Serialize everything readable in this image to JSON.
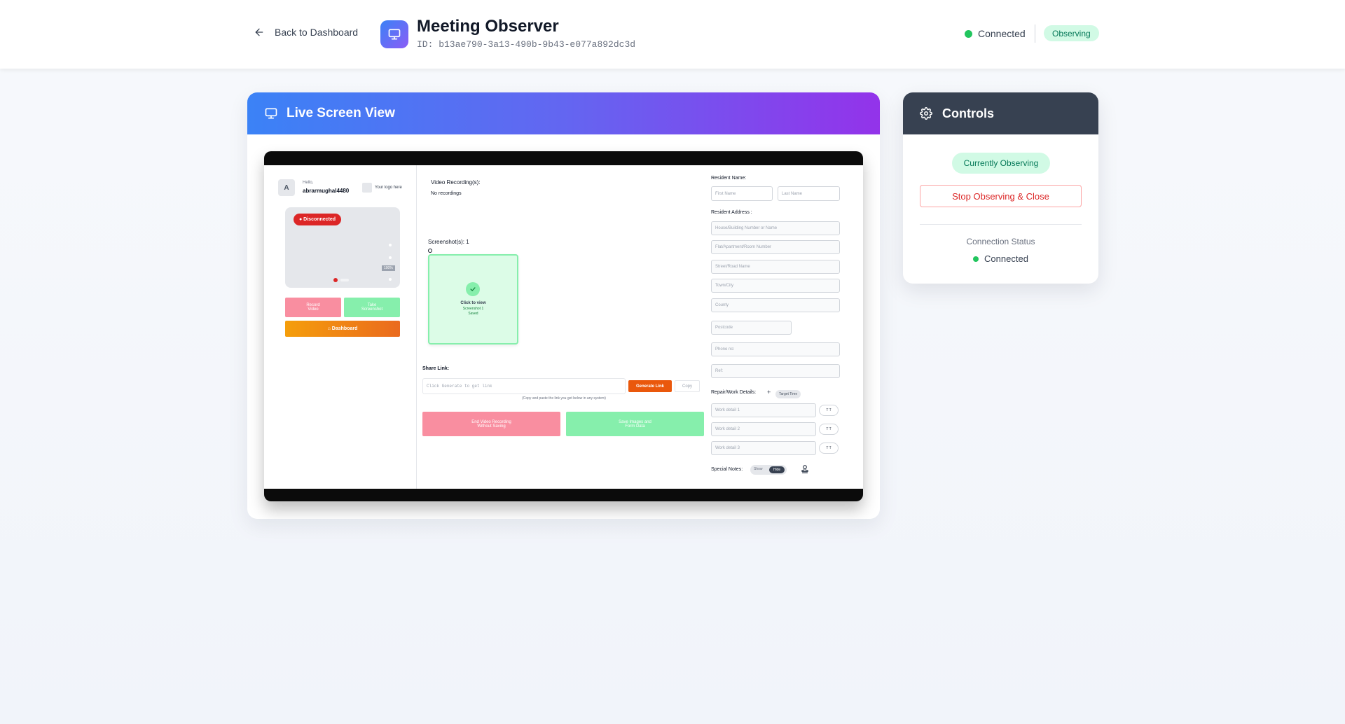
{
  "header": {
    "back_label": "Back to Dashboard",
    "title": "Meeting Observer",
    "id_text": "ID: b13ae790-3a13-490b-9b43-e077a892dc3d",
    "connection": "Connected",
    "observing_badge": "Observing"
  },
  "live": {
    "title": "Live Screen View"
  },
  "mini": {
    "avatar_letter": "A",
    "hello": "Hello,",
    "username": "abrarmughal4480",
    "logo_placeholder": "Your logo here",
    "disconnected": "● Disconnected",
    "zoom": "100%",
    "record_video": "Record\nVideo",
    "take_screenshot": "Take\nScreenshot",
    "dashboard": "⌂ Dashboard",
    "video_recordings_label": "Video Recording(s):",
    "no_recordings": "No recordings",
    "screenshots_label": "Screenshot(s): 1",
    "click_to_view": "Click to view",
    "screenshot_sub": "Screenshot 1",
    "saved": "Saved",
    "share_link": "Share Link:",
    "link_placeholder": "Click Generate to get link",
    "generate_link": "Generate Link",
    "copy": "Copy",
    "copy_hint": "(Copy and paste the link you get below in any system)",
    "end_video": "End Video Recording\nWithout Saving",
    "save_images": "Save Images and\nForm Data",
    "resident_name": "Resident Name:",
    "first_name": "First Name",
    "last_name": "Last Name",
    "resident_address": "Resident Address :",
    "house": "House/Building Number or Name",
    "flat": "Flat/Apartment/Room Number",
    "street": "Street/Road Name",
    "town": "Town/City",
    "county": "County",
    "postcode": "Postcode",
    "phone": "Phone no:",
    "ref": "Ref:",
    "repair_details": "Repair/Work Details:",
    "plus": "+",
    "target_time": "Target Time",
    "work1": "Work detail 1",
    "work2": "Work detail 2",
    "work3": "Work detail 3",
    "tt": "T T",
    "special_notes": "Special Notes:",
    "show": "Show",
    "hide": "Hide"
  },
  "controls": {
    "title": "Controls",
    "currently_observing": "Currently Observing",
    "stop_button": "Stop Observing & Close",
    "connection_status_label": "Connection Status",
    "connection_status_value": "Connected"
  },
  "colors": {
    "accent_green": "#22c55e",
    "danger": "#dc2626",
    "gradient_start": "#3b82f6",
    "gradient_end": "#9333ea",
    "controls_header": "#374151"
  }
}
